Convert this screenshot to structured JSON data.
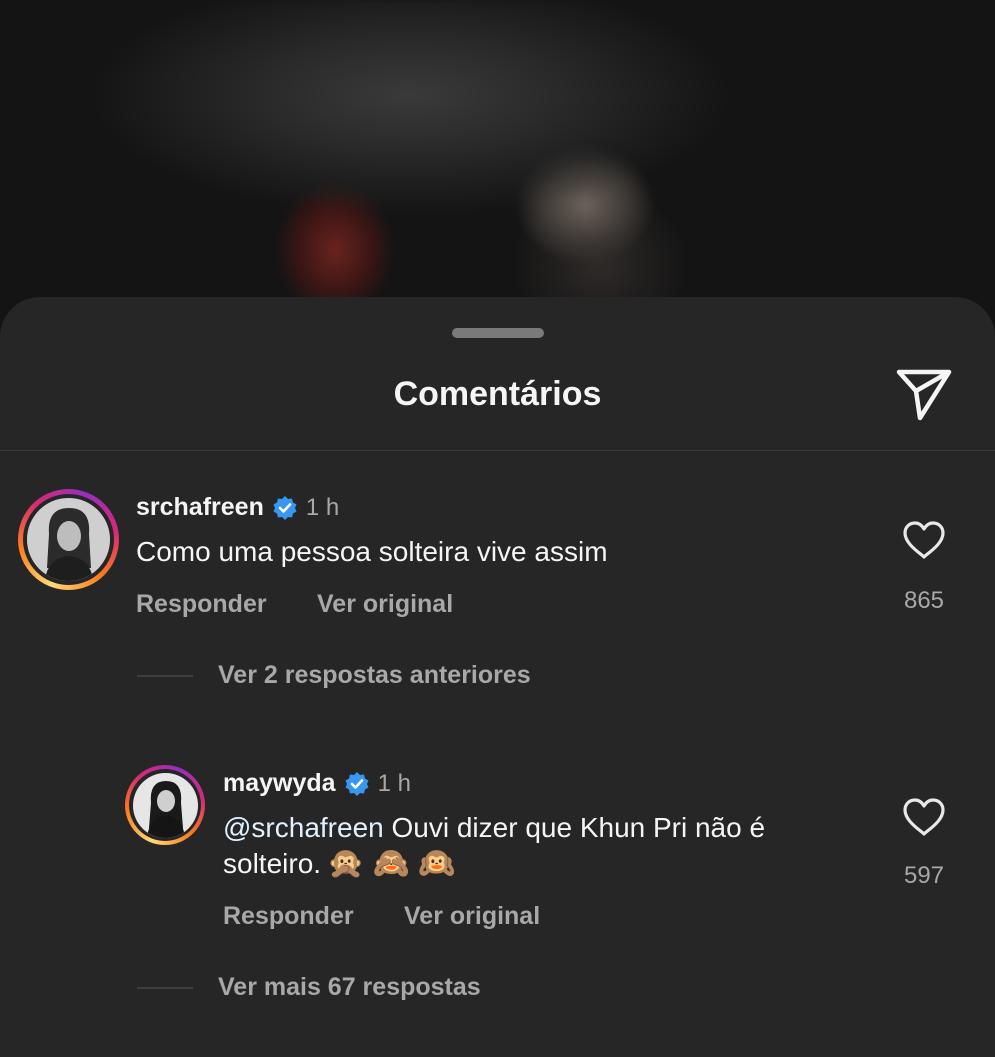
{
  "sheet": {
    "title": "Comentários"
  },
  "icons": {
    "share": "paper-plane-icon",
    "like": "heart-icon",
    "verified": "verified-badge-icon"
  },
  "colors": {
    "sheet_bg": "#262626",
    "verified": "#3897f0",
    "secondary_text": "#a8a8a8"
  },
  "comments": [
    {
      "username": "srchafreen",
      "time": "1 h",
      "text": "Como uma pessoa solteira vive assim",
      "reply_label": "Responder",
      "original_label": "Ver original",
      "likes": "865",
      "thread_link": "Ver 2 respostas anteriores"
    }
  ],
  "replies": [
    {
      "username": "maywyda",
      "time": "1 h",
      "mention": "@srchafreen",
      "text_line1": " Ouvi dizer que Khun Pri não é",
      "text_line2": "solteiro.",
      "emojis": "🙊 🙈 🙉",
      "reply_label": "Responder",
      "original_label": "Ver original",
      "likes": "597",
      "thread_link": "Ver mais 67 respostas"
    }
  ]
}
